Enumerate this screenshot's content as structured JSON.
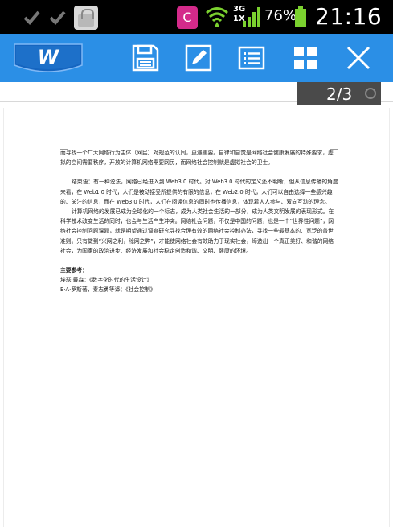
{
  "status_bar": {
    "battery_percent": "76%",
    "time": "21:16",
    "network_type_top": "3G",
    "network_type_bottom": "1X",
    "notification_app_letter": "C"
  },
  "toolbar": {
    "logo_letter": "W",
    "background_color": "#2b8fe6"
  },
  "page_indicator": {
    "text": "2/3"
  },
  "document": {
    "para1": "而寻找一个广大网络行为主体（网民）对规范的认同，更遇重要。自律和自觉是网络社会健康发展的特殊要求，虚拟的空间需要秩序，开放的计算机网络需要网民，而网络社会控制就是虚拟社会的卫士。",
    "para2": "结束语：有一种说法，网络已经进入到 Web3.0 时代。对 Web3.0 时代的定义还不明晰，但从信息传播的角度来看，在 Web1.0 时代，人们是被动接受所提供的有限的信息，在 Web2.0 时代，人们可以自由选择一些感兴趣的、关注的信息，而在 Web3.0 时代，人们在阅读信息的同时也传播信息，体现着人人参与、双向互动的理念。",
    "para3": "计算机网络的发展已成为全球化的一个标志，成为人类社会生活的一部分，成为人类文明发展的表现形式。在科学技术改变生活的同时，也会与生活产生冲突。网络社会问题，不仅是中国的问题，也是一个“世界性问题”，网络社会控制问题课题，就是期望通过调查研究寻找合理有效的网络社会控制办法，寻找一些最基本的、宽泛的普世准则。只有做到“兴网之利，除网之弊”，才能使网络社会有效助力于现实社会，缔造出一个真正美好、和谐的网络社会，为国家的政治进步、经济发展和社会稳定创造和谐、文明、健康的环境。",
    "refs_title": "主要参考：",
    "ref1": "埃瑟·戴森：《数字化时代的生活设计》",
    "ref2": "E·A·罗斯著，秦志勇等译：《社会控制》"
  }
}
